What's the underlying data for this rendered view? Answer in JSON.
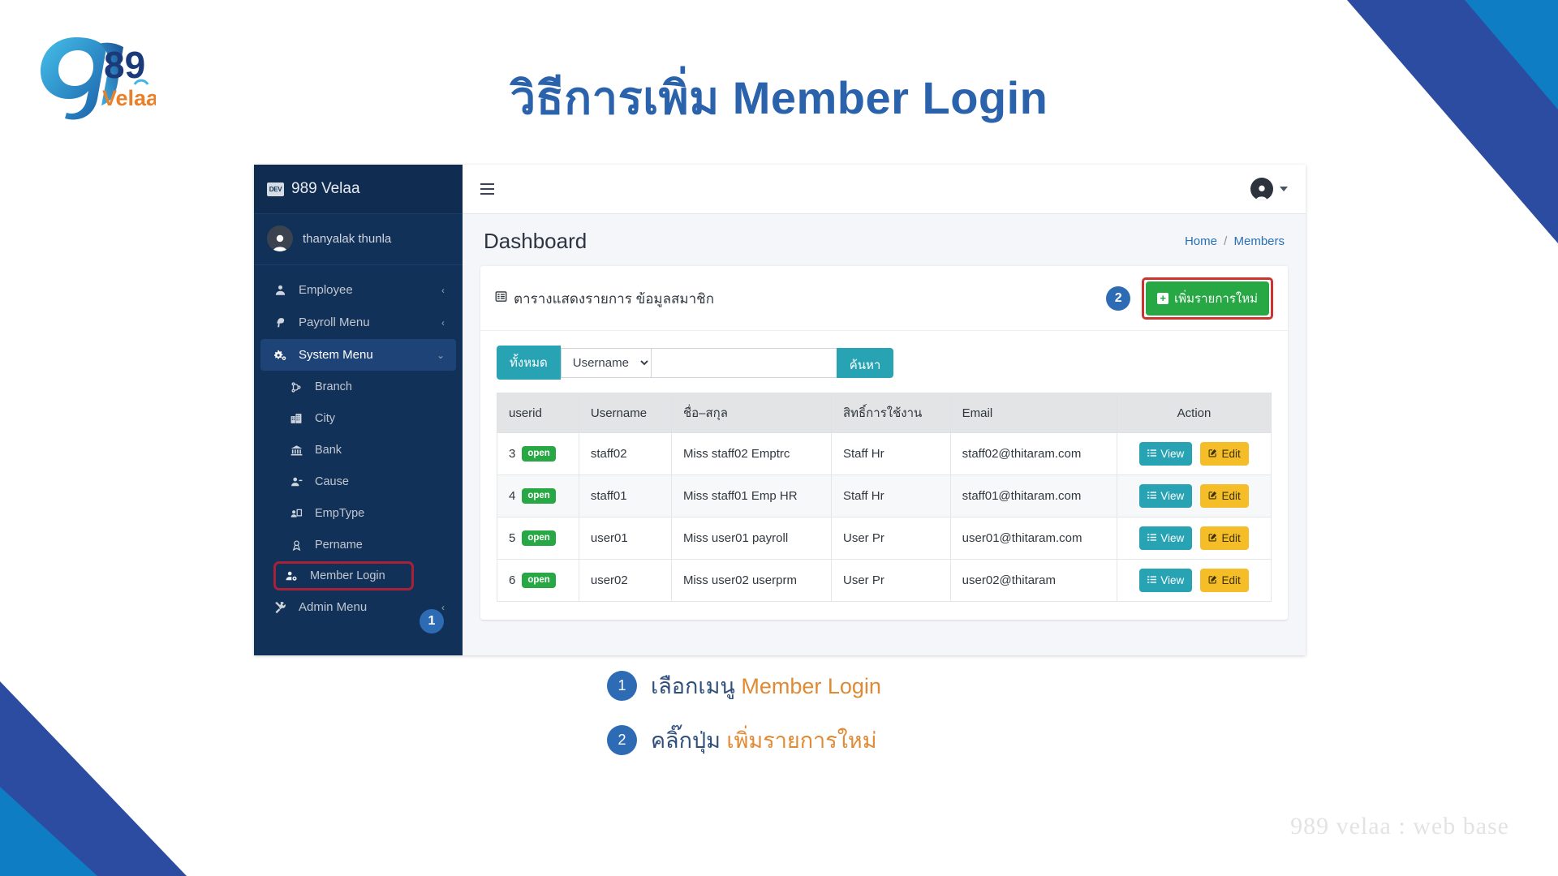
{
  "slide": {
    "title": "วิธีการเพิ่ม Member Login",
    "footer_note": "989 velaa : web base",
    "accent_blue": "#2a62ab",
    "accent_orange": "#e08a33",
    "corner_navy": "#2b4ca0",
    "corner_blue": "#0f7dc4"
  },
  "logo": {
    "numeral": "9",
    "digits": "89",
    "wordmark": "Velaa"
  },
  "sidebar": {
    "brand_badge": "DEV",
    "brand_name": "989 Velaa",
    "user": {
      "name": "thanyalak thunla",
      "avatar_icon": "user-avatar-icon"
    },
    "items": [
      {
        "label": "Employee",
        "icon": "user-icon",
        "chevron": "‹",
        "level": "top",
        "active": false
      },
      {
        "label": "Payroll Menu",
        "icon": "paypal-icon",
        "chevron": "‹",
        "level": "top",
        "active": false
      },
      {
        "label": "System Menu",
        "icon": "gears-icon",
        "chevron": "⌄",
        "level": "top",
        "active": true
      },
      {
        "label": "Branch",
        "icon": "sitemap-icon",
        "chevron": "",
        "level": "sub",
        "active": false
      },
      {
        "label": "City",
        "icon": "city-icon",
        "chevron": "",
        "level": "sub",
        "active": false
      },
      {
        "label": "Bank",
        "icon": "bank-icon",
        "chevron": "",
        "level": "sub",
        "active": false
      },
      {
        "label": "Cause",
        "icon": "user-minus-icon",
        "chevron": "",
        "level": "sub",
        "active": false
      },
      {
        "label": "EmpType",
        "icon": "id-card-icon",
        "chevron": "",
        "level": "sub",
        "active": false
      },
      {
        "label": "Pername",
        "icon": "ribbon-icon",
        "chevron": "",
        "level": "sub",
        "active": false
      },
      {
        "label": "Member Login",
        "icon": "user-cog-icon",
        "chevron": "",
        "level": "sub",
        "active": false,
        "highlighted": true
      },
      {
        "label": "Admin Menu",
        "icon": "tools-icon",
        "chevron": "‹",
        "level": "top",
        "active": false
      }
    ],
    "step_badge_1": "1"
  },
  "topbar": {
    "menu_toggle_icon": "hamburger-icon",
    "user_icon": "user-avatar-icon",
    "caret_icon": "caret-down-icon"
  },
  "page": {
    "heading": "Dashboard",
    "breadcrumb": {
      "home": "Home",
      "separator": "/",
      "current": "Members"
    }
  },
  "card": {
    "title": "ตารางแสดงรายการ ข้อมูลสมาชิก",
    "title_icon": "table-icon",
    "step_badge_2": "2",
    "add_button": {
      "label": "เพิ่มรายการใหม่",
      "icon": "plus-square-icon",
      "color": "#28a745",
      "highlight_color": "#d0332e"
    }
  },
  "filter": {
    "all_button": "ทั้งหมด",
    "select_value": "Username",
    "select_options": [
      "Username"
    ],
    "search_value": "",
    "search_placeholder": "",
    "search_button": "ค้นหา",
    "accent": "#27a3b4"
  },
  "table": {
    "columns": [
      "userid",
      "Username",
      "ชื่อ–สกุล",
      "สิทธิ์การใช้งาน",
      "Email",
      "Action"
    ],
    "rows": [
      {
        "userid": "3",
        "status": "open",
        "username": "staff02",
        "fullname": "Miss staff02 Emptrc",
        "role": "Staff Hr",
        "email": "staff02@thitaram.com",
        "view": "View",
        "edit": "Edit"
      },
      {
        "userid": "4",
        "status": "open",
        "username": "staff01",
        "fullname": "Miss staff01 Emp HR",
        "role": "Staff Hr",
        "email": "staff01@thitaram.com",
        "view": "View",
        "edit": "Edit"
      },
      {
        "userid": "5",
        "status": "open",
        "username": "user01",
        "fullname": "Miss user01 payroll",
        "role": "User Pr",
        "email": "user01@thitaram.com",
        "view": "View",
        "edit": "Edit"
      },
      {
        "userid": "6",
        "status": "open",
        "username": "user02",
        "fullname": "Miss user02 userprm",
        "role": "User Pr",
        "email": "user02@thitaram",
        "view": "View",
        "edit": "Edit"
      }
    ],
    "status_color": "#28a745",
    "view_color": "#27a3b4",
    "edit_color": "#f5bd28"
  },
  "annotations": [
    {
      "number": "1",
      "prefix": "เลือกเมนู ",
      "highlight": "Member Login"
    },
    {
      "number": "2",
      "prefix": "คลิ๊กปุ่ม ",
      "highlight": "เพิ่มรายการใหม่"
    }
  ]
}
